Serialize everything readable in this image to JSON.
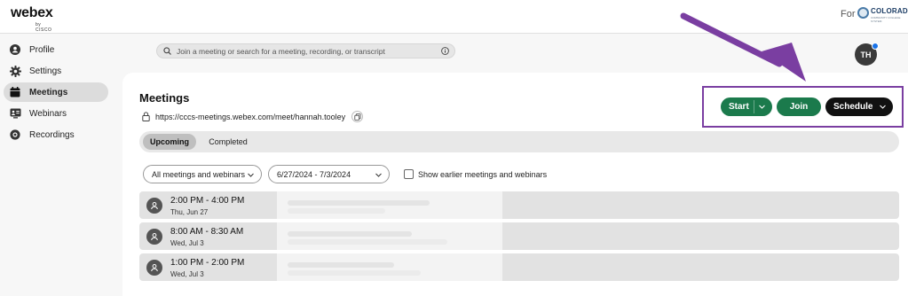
{
  "app": {
    "logo_main": "webex",
    "logo_sub": "by CISCO",
    "for_label": "For",
    "org_name": "COLORADO",
    "org_tag": "COMMUNITY COLLEGE SYSTEM"
  },
  "sidebar": {
    "items": [
      {
        "label": "Profile",
        "icon": "profile-icon",
        "active": false
      },
      {
        "label": "Settings",
        "icon": "gear-icon",
        "active": false
      },
      {
        "label": "Meetings",
        "icon": "calendar-icon",
        "active": true
      },
      {
        "label": "Webinars",
        "icon": "webinar-icon",
        "active": false
      },
      {
        "label": "Recordings",
        "icon": "recording-icon",
        "active": false
      }
    ]
  },
  "search": {
    "placeholder": "Join a meeting or search for a meeting, recording, or transcript"
  },
  "user": {
    "initials": "TH",
    "notification_color": "#1a73e8"
  },
  "main": {
    "title": "Meetings",
    "personal_room_url": "https://cccs-meetings.webex.com/meet/hannah.tooley"
  },
  "actions": {
    "start_label": "Start",
    "join_label": "Join",
    "schedule_label": "Schedule"
  },
  "tabs": [
    {
      "label": "Upcoming",
      "selected": true
    },
    {
      "label": "Completed",
      "selected": false
    }
  ],
  "filters": {
    "type_selected": "All meetings and webinars",
    "date_range": "6/27/2024 - 7/3/2024",
    "show_earlier_label": "Show earlier meetings and webinars",
    "show_earlier_checked": false
  },
  "meetings": [
    {
      "time": "2:00 PM - 4:00 PM",
      "date": "Thu, Jun 27"
    },
    {
      "time": "8:00 AM - 8:30 AM",
      "date": "Wed, Jul 3"
    },
    {
      "time": "1:00 PM - 2:00 PM",
      "date": "Wed, Jul 3"
    }
  ],
  "colors": {
    "accent_green": "#1b7a4c",
    "schedule_black": "#111111",
    "annotation_purple": "#7a3ea1"
  }
}
